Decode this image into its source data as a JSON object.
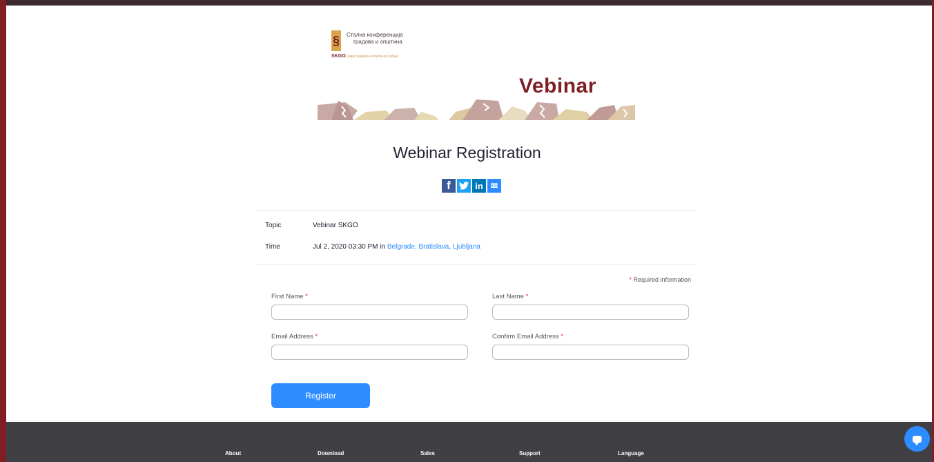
{
  "logo": {
    "line1": "Стална конференција",
    "line2": "градова и општина",
    "abbr": "SKGO",
    "subtitle": "Савез градова и општина Србије"
  },
  "banner": {
    "title": "Vebinar"
  },
  "page": {
    "title": "Webinar Registration"
  },
  "share": [
    {
      "icon": "facebook-icon",
      "glyph": "f",
      "color": "#3b5998"
    },
    {
      "icon": "twitter-icon",
      "glyph": "t",
      "color": "#1da1f2"
    },
    {
      "icon": "linkedin-icon",
      "glyph": "in",
      "color": "#0077b5"
    },
    {
      "icon": "email-icon",
      "glyph": "✉",
      "color": "#2d8cff"
    }
  ],
  "details": {
    "topic_label": "Topic",
    "topic_value": "Vebinar SKGO",
    "time_label": "Time",
    "time_value": "Jul 2, 2020 03:30 PM in",
    "timezone": "Belgrade, Bratislava, Ljubljana"
  },
  "form": {
    "required_star": "*",
    "required_note": "Required information",
    "first_name_label": "First Name",
    "first_name_value": "",
    "last_name_label": "Last Name",
    "last_name_value": "",
    "email_label": "Email Address",
    "email_value": "",
    "confirm_email_label": "Confirm Email Address",
    "confirm_email_value": "",
    "register_label": "Register"
  },
  "footer": {
    "links": [
      "About",
      "Download",
      "Sales",
      "Support",
      "Language"
    ]
  },
  "colors": {
    "accent": "#2d8cff",
    "brand": "#7d1f24",
    "footer_bg": "#3f3f44",
    "required": "#e02828"
  }
}
